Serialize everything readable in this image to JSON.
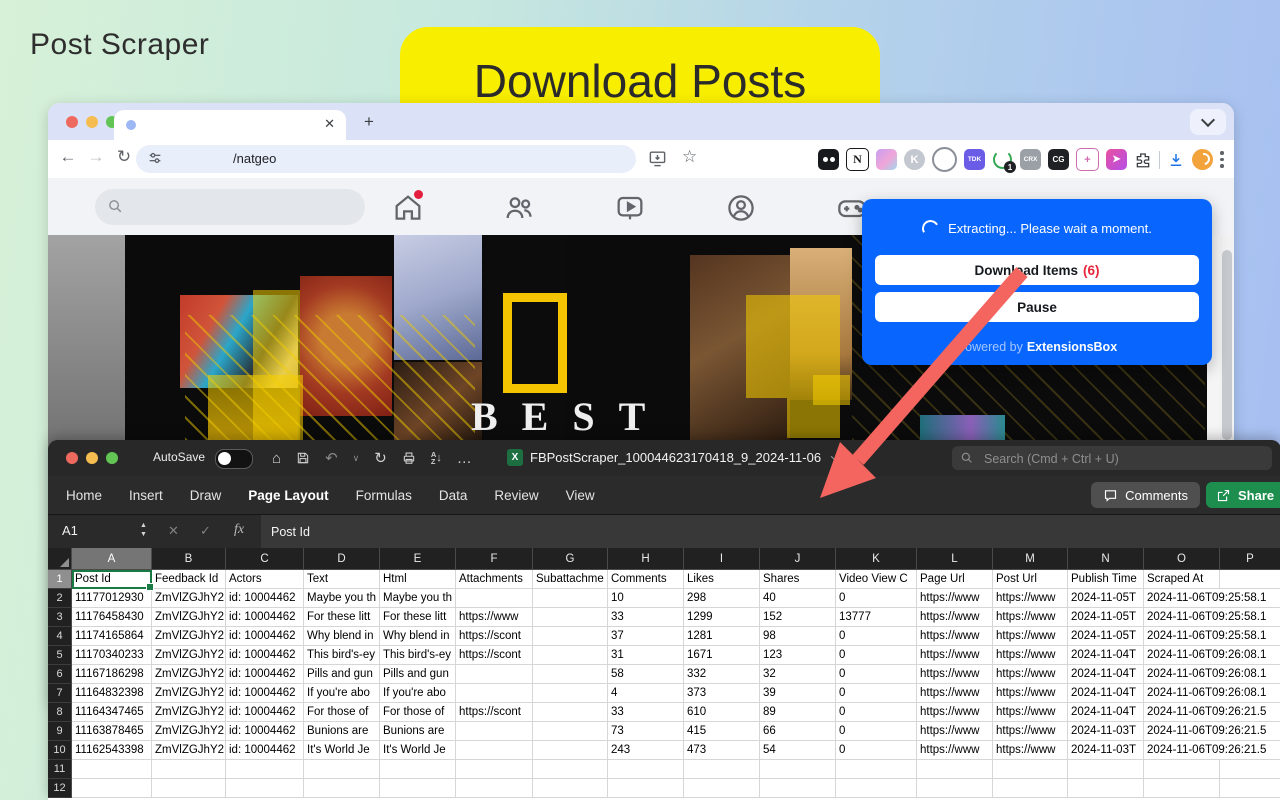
{
  "page": {
    "title": "Post Scraper",
    "banner": "Download Posts",
    "colors": {
      "banner_bg": "#F8EE00",
      "popup_blue": "#0866FF",
      "arrow_red": "#F4655F",
      "excel_green": "#1E8E4F",
      "selection_green": "#1A7A44"
    }
  },
  "browser": {
    "url": "/natgeo",
    "icons": {
      "back": "←",
      "forward": "→",
      "reload": "↻",
      "star": "☆",
      "close_tab": "✕",
      "new_tab": "+"
    },
    "extensions": {
      "notion": "N",
      "k": "K",
      "tdk": "TDK",
      "crx": "CRX",
      "cg": "CG",
      "window_add": "+",
      "power_badge": "1"
    }
  },
  "facebook": {
    "collage_headline": "BEST"
  },
  "popup": {
    "status": "Extracting... Please wait a moment.",
    "download_button": "Download Items",
    "download_count": "(6)",
    "pause_button": "Pause",
    "powered_by": "Powered by",
    "brand": "ExtensionsBox"
  },
  "excel": {
    "autosave": "AutoSave",
    "doc_icon": "X",
    "filename": "FBPostScraper_100044623170418_9_2024-11-06",
    "search_placeholder": "Search (Cmd + Ctrl + U)",
    "menu_tabs": [
      "Home",
      "Insert",
      "Draw",
      "Page Layout",
      "Formulas",
      "Data",
      "Review",
      "View"
    ],
    "active_tab": "Page Layout",
    "comments": "Comments",
    "share": "Share",
    "name_box": "A1",
    "formula_fx": "fx",
    "formula_value": "Post Id",
    "more_icon": "…",
    "undo_icon": "↶",
    "refresh_icon": "↻",
    "home_icon": "⌂"
  },
  "sheet": {
    "column_letters": [
      "A",
      "B",
      "C",
      "D",
      "E",
      "F",
      "G",
      "H",
      "I",
      "J",
      "K",
      "L",
      "M",
      "N",
      "O",
      "P"
    ],
    "row_numbers": [
      "1",
      "2",
      "3",
      "4",
      "5",
      "6",
      "7",
      "8",
      "9",
      "10",
      "11",
      "12"
    ],
    "rows": [
      [
        "Post Id",
        "Feedback Id",
        "Actors",
        "Text",
        "Html",
        "Attachments",
        "Subattachme",
        "Comments",
        "Likes",
        "Shares",
        "Video View C",
        "Page Url",
        "Post Url",
        "Publish Time",
        "Scraped At",
        ""
      ],
      [
        "11177012930",
        "ZmVlZGJhY2",
        "id: 10004462",
        "Maybe you th",
        "Maybe you th",
        "",
        "",
        "10",
        "298",
        "40",
        "0",
        "https://www",
        "https://www",
        "2024-11-05T",
        "2024-11-06T09:25:58.1"
      ],
      [
        "11176458430",
        "ZmVlZGJhY2",
        "id: 10004462",
        "For these litt",
        "For these litt",
        "https://www",
        "",
        "33",
        "1299",
        "152",
        "13777",
        "https://www",
        "https://www",
        "2024-11-05T",
        "2024-11-06T09:25:58.1"
      ],
      [
        "11174165864",
        "ZmVlZGJhY2",
        "id: 10004462",
        "Why blend in",
        "Why blend in",
        "https://scont",
        "",
        "37",
        "1281",
        "98",
        "0",
        "https://www",
        "https://www",
        "2024-11-05T",
        "2024-11-06T09:25:58.1"
      ],
      [
        "11170340233",
        "ZmVlZGJhY2",
        "id: 10004462",
        "This bird's-ey",
        "This bird's-ey",
        "https://scont",
        "",
        "31",
        "1671",
        "123",
        "0",
        "https://www",
        "https://www",
        "2024-11-04T",
        "2024-11-06T09:26:08.1"
      ],
      [
        "11167186298",
        "ZmVlZGJhY2",
        "id: 10004462",
        "Pills and gun",
        "Pills and gun",
        "",
        "",
        "58",
        "332",
        "32",
        "0",
        "https://www",
        "https://www",
        "2024-11-04T",
        "2024-11-06T09:26:08.1"
      ],
      [
        "11164832398",
        "ZmVlZGJhY2",
        "id: 10004462",
        "If you're abo",
        "If you're abo",
        "",
        "",
        "4",
        "373",
        "39",
        "0",
        "https://www",
        "https://www",
        "2024-11-04T",
        "2024-11-06T09:26:08.1"
      ],
      [
        "11164347465",
        "ZmVlZGJhY2",
        "id: 10004462",
        "For those of",
        "For those of",
        "https://scont",
        "",
        "33",
        "610",
        "89",
        "0",
        "https://www",
        "https://www",
        "2024-11-04T",
        "2024-11-06T09:26:21.5"
      ],
      [
        "11163878465",
        "ZmVlZGJhY2",
        "id: 10004462",
        "Bunions are",
        "Bunions are",
        "",
        "",
        "73",
        "415",
        "66",
        "0",
        "https://www",
        "https://www",
        "2024-11-03T",
        "2024-11-06T09:26:21.5"
      ],
      [
        "11162543398",
        "ZmVlZGJhY2",
        "id: 10004462",
        "It's World Je",
        "It's World Je",
        "",
        "",
        "243",
        "473",
        "54",
        "0",
        "https://www",
        "https://www",
        "2024-11-03T",
        "2024-11-06T09:26:21.5"
      ],
      [],
      []
    ]
  }
}
